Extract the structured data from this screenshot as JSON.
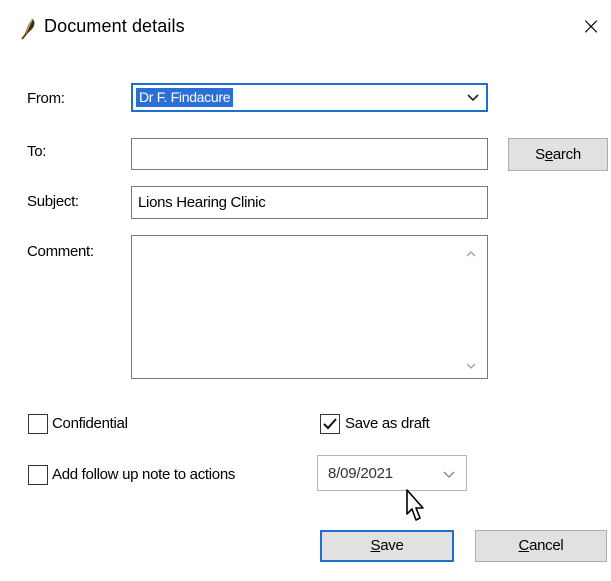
{
  "window": {
    "title": "Document details",
    "close_glyph": "×"
  },
  "form": {
    "from_label": "From:",
    "from_value": "Dr F. Findacure",
    "to_label": "To:",
    "to_value": "",
    "search_button": {
      "pre": "S",
      "mnemonic": "e",
      "post": "arch"
    },
    "subject_label": "Subject:",
    "subject_value": "Lions Hearing Clinic",
    "comment_label": "Comment:",
    "comment_value": ""
  },
  "options": {
    "confidential_label": "Confidential",
    "confidential_checked": false,
    "save_as_draft_label": "Save as draft",
    "save_as_draft_checked": true,
    "follow_up_label": "Add follow up note to actions",
    "follow_up_checked": false,
    "follow_up_date": "8/09/2021"
  },
  "footer": {
    "save_button": {
      "mnemonic": "S",
      "rest": "ave"
    },
    "cancel_button": {
      "mnemonic": "C",
      "rest": "ancel"
    }
  },
  "icons": {
    "title": "feather-pen-icon",
    "dropdown": "chevron-down-icon",
    "checkmark": "checkmark-icon",
    "cursor": "mouse-pointer-icon"
  },
  "colors": {
    "focus_border": "#1f6fcf",
    "selection": "#2a6fd6",
    "button_face": "#e1e1e1"
  }
}
